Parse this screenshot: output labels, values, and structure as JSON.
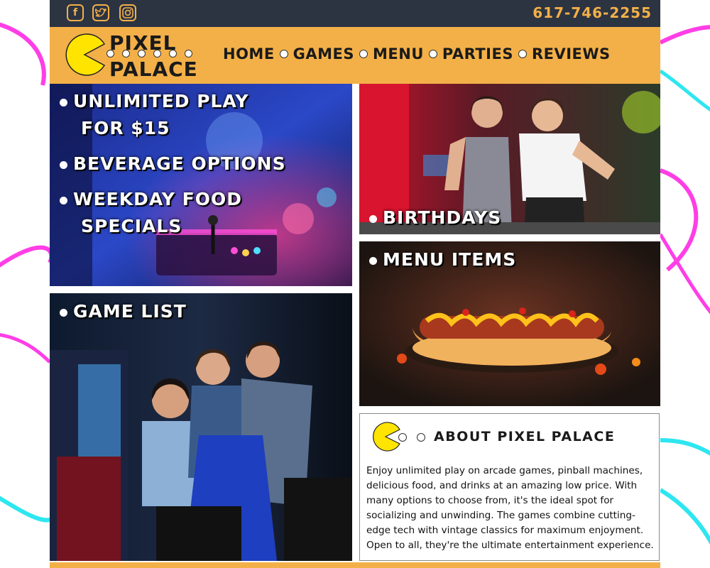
{
  "header": {
    "social": [
      {
        "name": "facebook",
        "glyph": "f"
      },
      {
        "name": "twitter",
        "glyph": "t"
      },
      {
        "name": "instagram",
        "glyph": "◎"
      }
    ],
    "phone": "617-746-2255"
  },
  "brand": {
    "line1": "PIXEL",
    "line2": "PALACE"
  },
  "nav": [
    "HOME",
    "GAMES",
    "MENU",
    "PARTIES",
    "REVIEWS"
  ],
  "promo": {
    "items": [
      {
        "line1": "UNLIMITED PLAY",
        "line2": "FOR $15"
      },
      {
        "line1": "BEVERAGE OPTIONS",
        "line2": ""
      },
      {
        "line1": "WEEKDAY FOOD",
        "line2": "SPECIALS"
      }
    ]
  },
  "tiles": {
    "birthdays": "BIRTHDAYS",
    "menu_items": "MENU ITEMS",
    "game_list": "GAME LIST"
  },
  "about": {
    "title": "ABOUT PIXEL PALACE",
    "body": "Enjoy unlimited play on arcade games, pinball machines, delicious food, and drinks at an amazing low price. With many options to choose from, it's the ideal spot for socializing and unwinding. The games combine cutting-edge tech with vintage classics for maximum enjoyment. Open to all, they're the ultimate entertainment experience."
  },
  "colors": {
    "accent": "#f3b048",
    "topbar": "#2c3442",
    "pacman": "#ffe400",
    "swirl_pink": "#ff3ee6",
    "swirl_cyan": "#2ee6f0"
  }
}
